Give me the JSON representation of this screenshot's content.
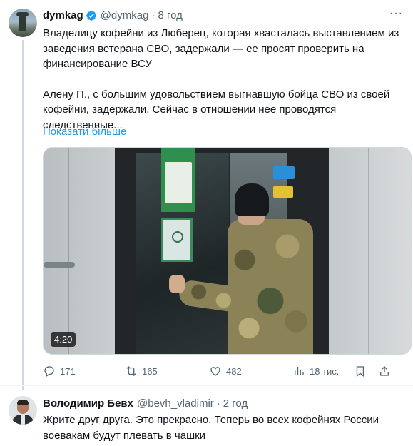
{
  "tweet": {
    "author_name": "dymkag",
    "handle": "@dymkag",
    "separator": "·",
    "time": "8 год",
    "more": "···",
    "paragraph1": "Владелицу кофейни из Люберец, которая хвасталась выставлением из заведения ветерана СВО, задержали — ее просят проверить на финансирование ВСУ",
    "paragraph2": "Алену П., с большим удовольствием выгнавшую бойца СВО из своей кофейни, задержали. Сейчас в отношении нее проводятся следственные...",
    "show_more": "Показати більше",
    "video_duration": "4:20",
    "stats": {
      "replies": "171",
      "retweets": "165",
      "likes": "482",
      "views": "18 тис."
    },
    "verified_color": "#1d9bf0",
    "icons": [
      "verified-badge-icon",
      "reply-icon",
      "retweet-icon",
      "like-icon",
      "views-icon",
      "bookmark-icon",
      "share-icon"
    ]
  },
  "reply": {
    "author_name": "Володимир Бевх",
    "handle": "@bevh_vladimir",
    "separator": "·",
    "time": "2 год",
    "text": "Жрите друг друга. Это прекрасно. Теперь во всех кофейнях России воевакам будут плевать в чашки"
  },
  "colors": {
    "accent": "#1d9bf0",
    "secondary_text": "#536471",
    "primary_text": "#0f1419"
  }
}
